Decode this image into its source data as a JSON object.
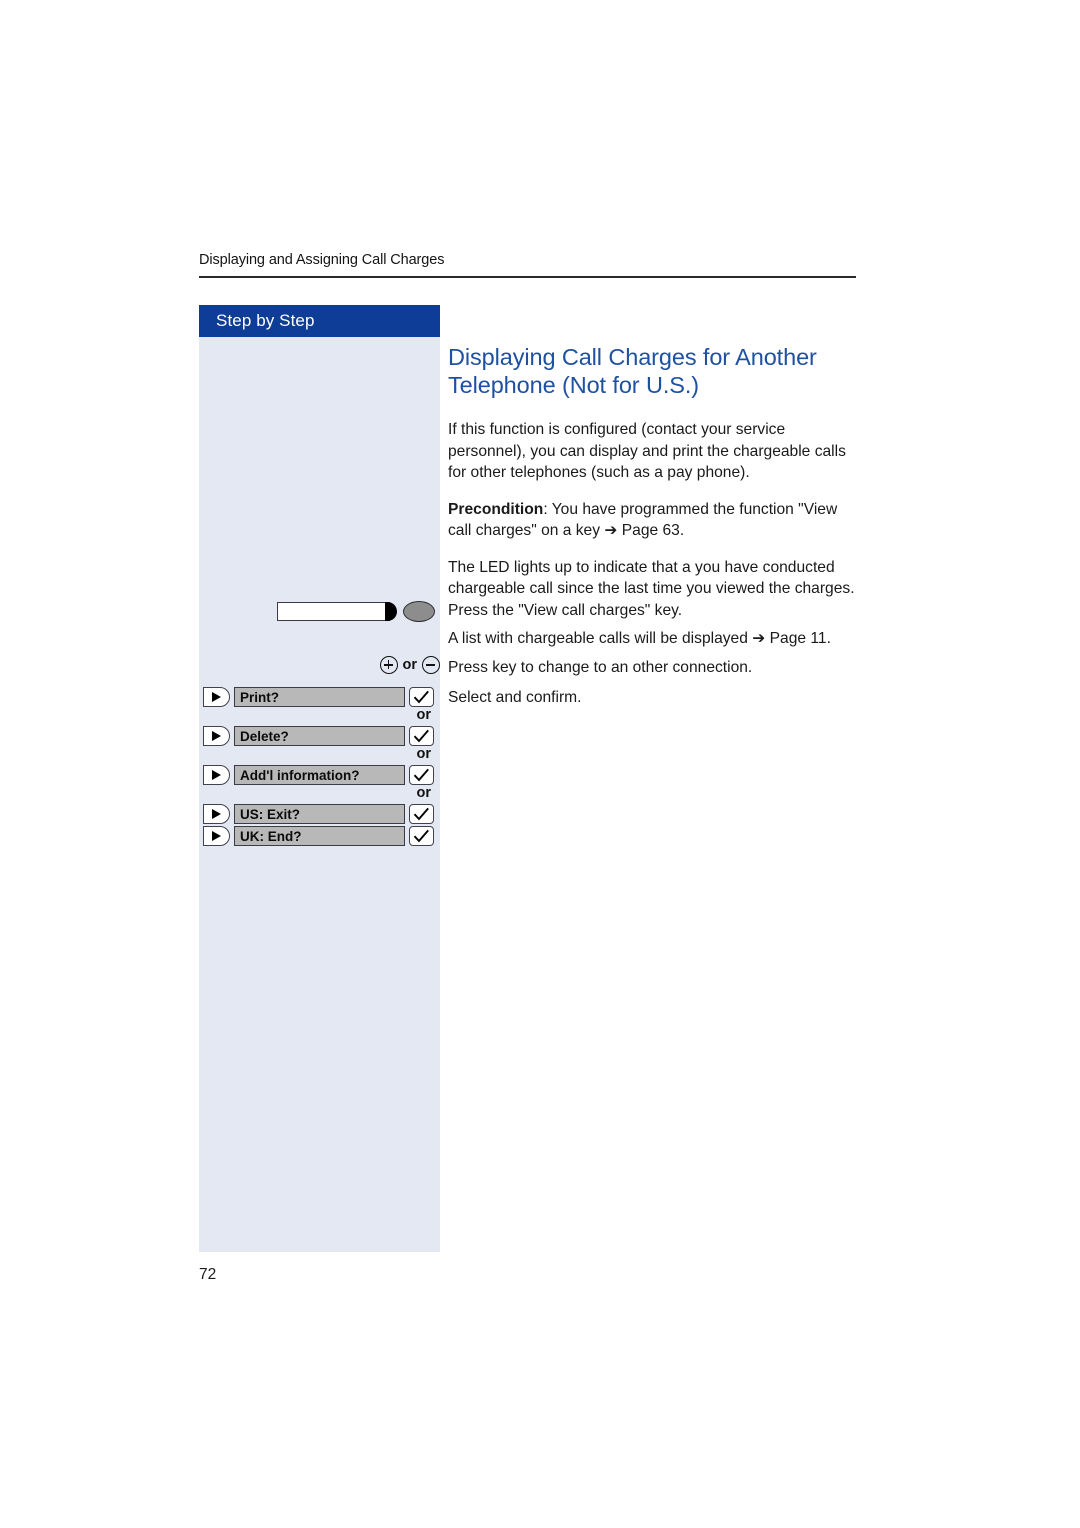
{
  "document": {
    "running_header": "Displaying and Assigning Call Charges",
    "page_number": "72",
    "title": "Displaying Call Charges for Another Telephone (Not for U.S.)"
  },
  "sidebar": {
    "title": "Step by Step",
    "key_graphic_name": "function-key-with-led",
    "plus_label": "+",
    "minus_label": "−",
    "or_label": "or",
    "softkeys": [
      {
        "label": "Print?",
        "or_after": true
      },
      {
        "label": "Delete?",
        "or_after": true
      },
      {
        "label": "Add'l information?",
        "or_after": true
      },
      {
        "label": "US: Exit?",
        "or_after": false
      },
      {
        "label": "UK: End?",
        "or_after": false
      }
    ]
  },
  "body": {
    "paragraph_1": "If this function is configured (contact your service personnel), you can display and print the chargeable calls for other telephones (such as a pay phone).",
    "precondition_label": "Precondition",
    "precondition_rest": ": You have programmed the function \"View call charges\" on a key ➔ Page 63.",
    "paragraph_2": "The LED lights up to indicate that a you have conducted chargeable call since the last time you viewed the charges.",
    "step_1": "Press the \"View call charges\" key.",
    "step_2": "A list with chargeable calls will be displayed ➔ Page 11.",
    "step_3": "Press key to change to an other connection.",
    "step_4": "Select and confirm."
  },
  "colors": {
    "title_bar_blue": "#0d3d96",
    "sidebar_background": "#e4e8f3",
    "heading_blue": "#1f51a2",
    "display_bar_gray": "#b8b8b8"
  }
}
